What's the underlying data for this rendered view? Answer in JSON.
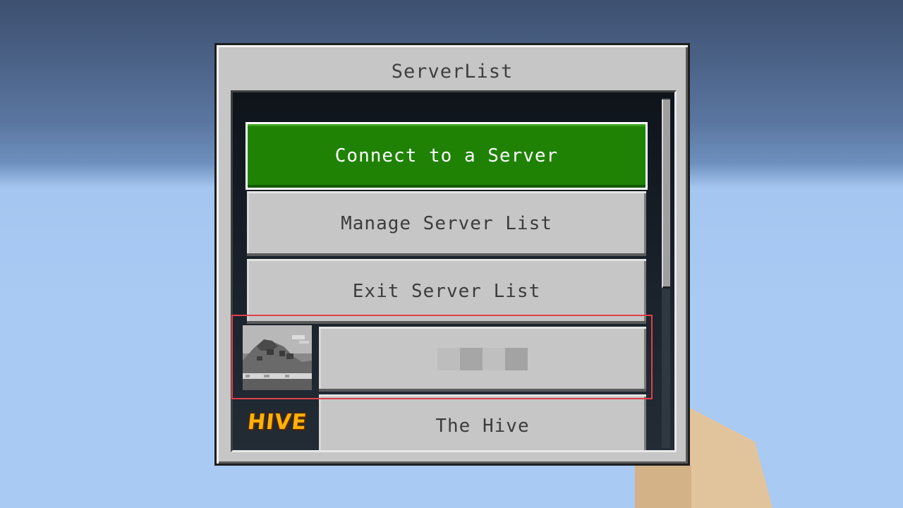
{
  "window": {
    "title": "ServerList"
  },
  "buttons": {
    "connect_label": "Connect to a Server",
    "manage_label": "Manage Server List",
    "exit_label": "Exit Server List"
  },
  "servers": [
    {
      "name": "",
      "name_redacted": true,
      "icon": "landscape-thumbnail-icon"
    },
    {
      "name": "The Hive",
      "logo_text": "HIVE",
      "icon": "hive-logo-icon"
    }
  ],
  "colors": {
    "connect_button": "#1f8205",
    "button_grey": "#c6c6c6",
    "highlight_box": "#e0404a",
    "hive_logo": "#ffb20a"
  }
}
